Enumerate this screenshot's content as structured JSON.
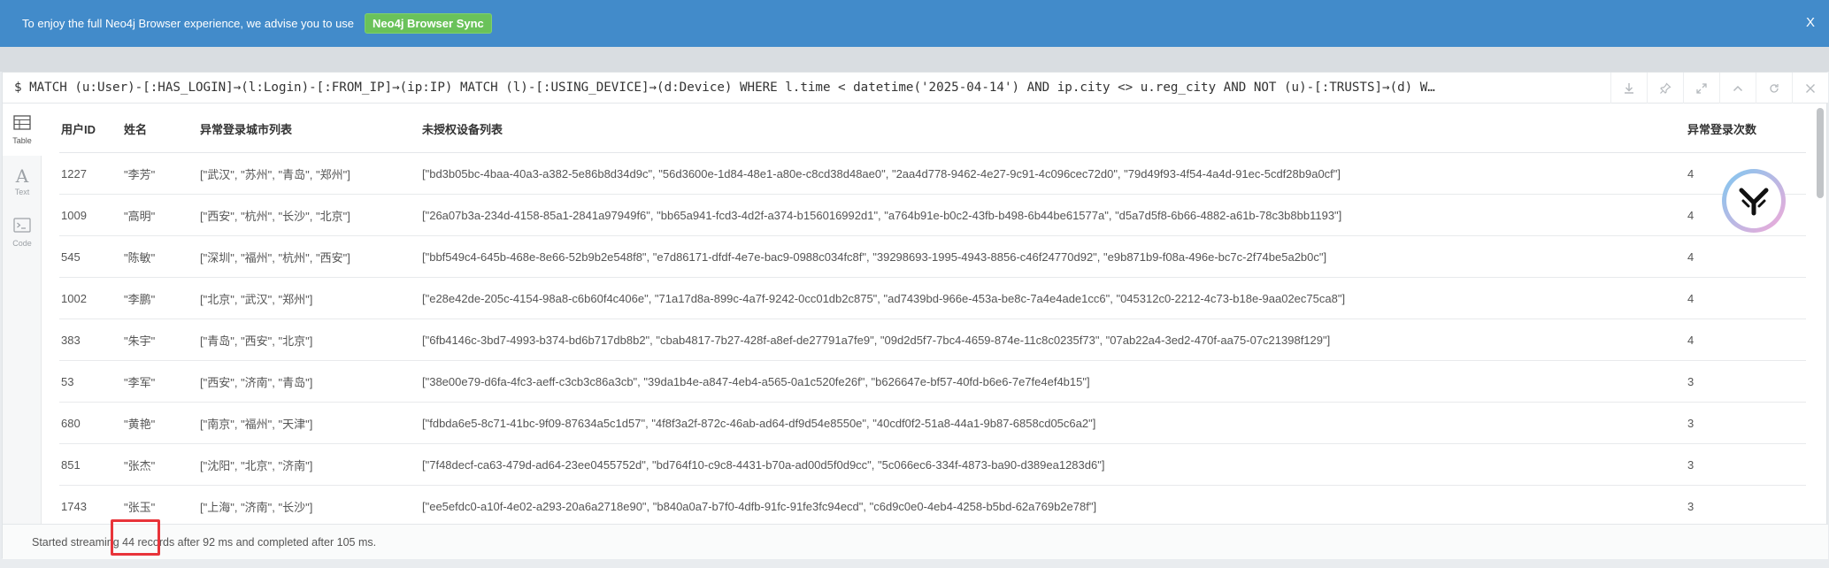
{
  "banner": {
    "message": "To enjoy the full Neo4j Browser experience, we advise you to use",
    "sync_label": "Neo4j Browser Sync",
    "close_label": "X"
  },
  "editor": {
    "query": "$ MATCH (u:User)-[:HAS_LOGIN]→(l:Login)-[:FROM_IP]→(ip:IP) MATCH (l)-[:USING_DEVICE]→(d:Device) WHERE l.time < datetime('2025-04-14') AND ip.city <> u.reg_city AND NOT (u)-[:TRUSTS]→(d) W…",
    "toolbar_icons": [
      "download-icon",
      "pin-icon",
      "expand-icon",
      "collapse-up-icon",
      "rerun-icon",
      "close-icon"
    ]
  },
  "sidebar": {
    "items": [
      {
        "label": "Table",
        "icon": "table-icon",
        "active": true
      },
      {
        "label": "Text",
        "icon": "text-icon",
        "active": false
      },
      {
        "label": "Code",
        "icon": "code-icon",
        "active": false
      }
    ]
  },
  "table": {
    "columns": [
      "用户ID",
      "姓名",
      "异常登录城市列表",
      "未授权设备列表",
      "异常登录次数"
    ],
    "rows": [
      [
        "1227",
        "\"李芳\"",
        "[\"武汉\", \"苏州\", \"青岛\", \"郑州\"]",
        "[\"bd3b05bc-4baa-40a3-a382-5e86b8d34d9c\", \"56d3600e-1d84-48e1-a80e-c8cd38d48ae0\", \"2aa4d778-9462-4e27-9c91-4c096cec72d0\", \"79d49f93-4f54-4a4d-91ec-5cdf28b9a0cf\"]",
        "4"
      ],
      [
        "1009",
        "\"高明\"",
        "[\"西安\", \"杭州\", \"长沙\", \"北京\"]",
        "[\"26a07b3a-234d-4158-85a1-2841a97949f6\", \"bb65a941-fcd3-4d2f-a374-b156016992d1\", \"a764b91e-b0c2-43fb-b498-6b44be61577a\", \"d5a7d5f8-6b66-4882-a61b-78c3b8bb1193\"]",
        "4"
      ],
      [
        "545",
        "\"陈敏\"",
        "[\"深圳\", \"福州\", \"杭州\", \"西安\"]",
        "[\"bbf549c4-645b-468e-8e66-52b9b2e548f8\", \"e7d86171-dfdf-4e7e-bac9-0988c034fc8f\", \"39298693-1995-4943-8856-c46f24770d92\", \"e9b871b9-f08a-496e-bc7c-2f74be5a2b0c\"]",
        "4"
      ],
      [
        "1002",
        "\"李鹏\"",
        "[\"北京\", \"武汉\", \"郑州\"]",
        "[\"e28e42de-205c-4154-98a8-c6b60f4c406e\", \"71a17d8a-899c-4a7f-9242-0cc01db2c875\", \"ad7439bd-966e-453a-be8c-7a4e4ade1cc6\", \"045312c0-2212-4c73-b18e-9aa02ec75ca8\"]",
        "4"
      ],
      [
        "383",
        "\"朱宇\"",
        "[\"青岛\", \"西安\", \"北京\"]",
        "[\"6fb4146c-3bd7-4993-b374-bd6b717db8b2\", \"cbab4817-7b27-428f-a8ef-de27791a7fe9\", \"09d2d5f7-7bc4-4659-874e-11c8c0235f73\", \"07ab22a4-3ed2-470f-aa75-07c21398f129\"]",
        "4"
      ],
      [
        "53",
        "\"李军\"",
        "[\"西安\", \"济南\", \"青岛\"]",
        "[\"38e00e79-d6fa-4fc3-aeff-c3cb3c86a3cb\", \"39da1b4e-a847-4eb4-a565-0a1c520fe26f\", \"b626647e-bf57-40fd-b6e6-7e7fe4ef4b15\"]",
        "3"
      ],
      [
        "680",
        "\"黄艳\"",
        "[\"南京\", \"福州\", \"天津\"]",
        "[\"fdbda6e5-8c71-41bc-9f09-87634a5c1d57\", \"4f8f3a2f-872c-46ab-ad64-df9d54e8550e\", \"40cdf0f2-51a8-44a1-9b87-6858cd05c6a2\"]",
        "3"
      ],
      [
        "851",
        "\"张杰\"",
        "[\"沈阳\", \"北京\", \"济南\"]",
        "[\"7f48decf-ca63-479d-ad64-23ee0455752d\", \"bd764f10-c9c8-4431-b70a-ad00d5f0d9cc\", \"5c066ec6-334f-4873-ba90-d389ea1283d6\"]",
        "3"
      ],
      [
        "1743",
        "\"张玉\"",
        "[\"上海\", \"济南\", \"长沙\"]",
        "[\"ee5efdc0-a10f-4e02-a293-20a6a2718e90\", \"b840a0a7-b7f0-4dfb-91fc-91fe3fc94ecd\", \"c6d9c0e0-4eb4-4258-b5bd-62a769b2e78f\"]",
        "3"
      ]
    ]
  },
  "status": {
    "text": "Started streaming 44 records after 92 ms and completed after 105 ms."
  },
  "colors": {
    "banner_bg": "#428bca",
    "sync_button_bg": "#6ac25a",
    "highlight": "#e8343a"
  }
}
